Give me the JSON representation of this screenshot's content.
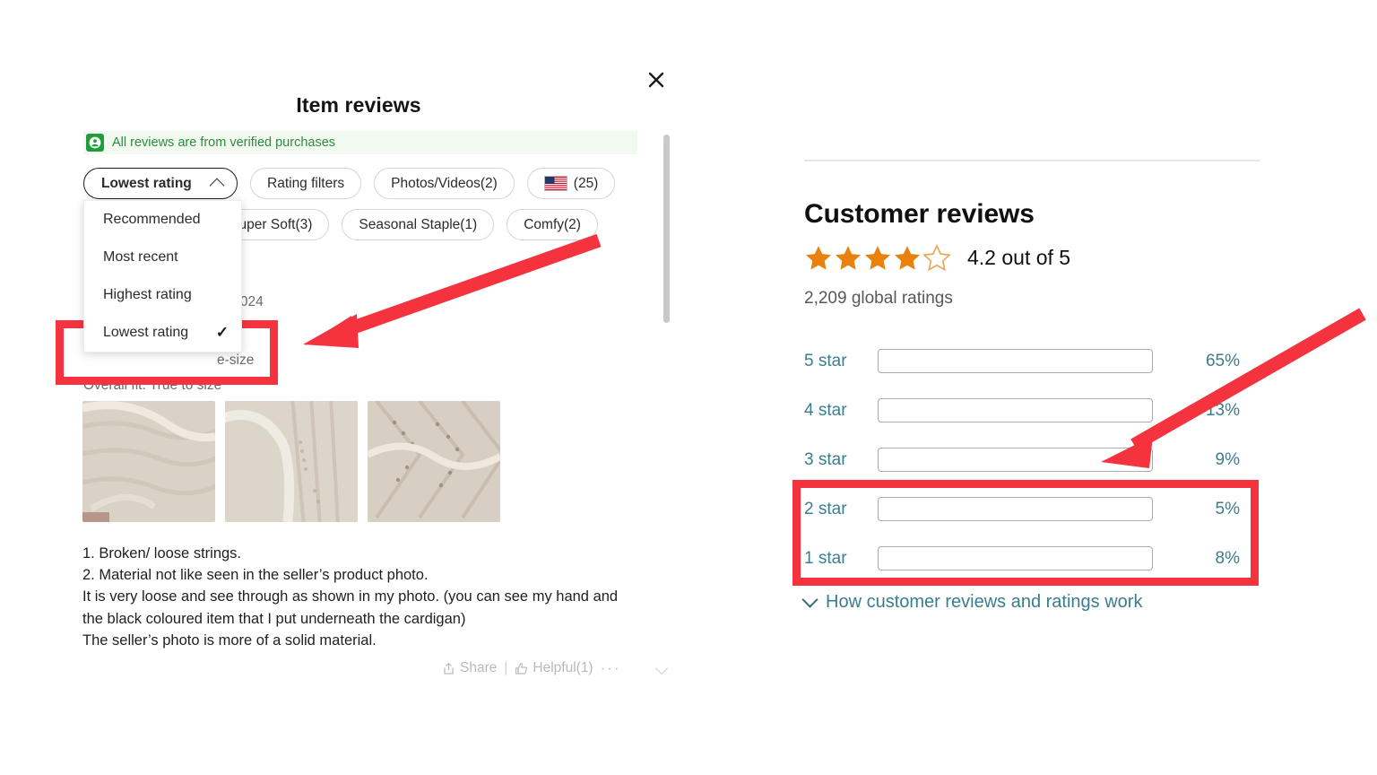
{
  "colors": {
    "annotation_red": "#f5333f",
    "bar_orange": "#e07b16",
    "link_teal": "#3a7d8c",
    "verified_green": "#2e8b3c"
  },
  "left_panel": {
    "title": "Item reviews",
    "close_label": "Close",
    "verified_banner": "All reviews are from verified purchases",
    "chips_row_1": [
      {
        "label": "Lowest rating",
        "type": "sort",
        "expanded": true
      },
      {
        "label": "Rating filters",
        "type": "filter"
      },
      {
        "label": "Photos/Videos(2)",
        "type": "filter"
      },
      {
        "label": "(25)",
        "type": "country",
        "flag": "us-flag-icon"
      }
    ],
    "chips_row_2": [
      {
        "label": "Super Soft(3)",
        "type": "filter"
      },
      {
        "label": "Seasonal Staple(1)",
        "type": "filter"
      },
      {
        "label": "Comfy(2)",
        "type": "filter"
      }
    ],
    "sort_dropdown": {
      "options": [
        {
          "label": "Recommended",
          "selected": false
        },
        {
          "label": "Most recent",
          "selected": false
        },
        {
          "label": "Highest rating",
          "selected": false
        },
        {
          "label": "Lowest rating",
          "selected": true
        }
      ],
      "check_glyph": "✓"
    },
    "review": {
      "date_fragment": "8, 2024",
      "size_fragment": "e-size",
      "overall_fit": "Overall fit: True to size",
      "photo_count": 3,
      "body": "1. Broken/ loose strings.\n2. Material not like seen in the seller’s product photo.\nIt is very loose and see through as shown in my photo. (you can see my hand and the black coloured item that I put underneath the cardigan)\nThe seller’s photo is more of a solid material.",
      "actions": {
        "share": "Share",
        "separator": "|",
        "helpful": "Helpful(1)",
        "more": "···"
      }
    }
  },
  "right_panel": {
    "title": "Customer reviews",
    "stars_filled": 4,
    "stars_total": 5,
    "score_text": "4.2 out of 5",
    "global_ratings": "2,209 global ratings",
    "how_link": "How customer reviews and ratings work"
  },
  "chart_data": {
    "type": "bar",
    "title": "Customer reviews rating distribution",
    "orientation": "horizontal",
    "categories": [
      "5 star",
      "4 star",
      "3 star",
      "2 star",
      "1 star"
    ],
    "values": [
      65,
      13,
      9,
      5,
      8
    ],
    "value_labels": [
      "65%",
      "13%",
      "9%",
      "5%",
      "8%"
    ],
    "xlabel": "",
    "ylabel": "",
    "xlim": [
      0,
      100
    ],
    "grid": false,
    "legend": false,
    "bar_color": "#e07b16",
    "track_color": "#ffffff",
    "label_color": "#3a7d8c",
    "average": 4.2,
    "total_ratings": 2209
  },
  "annotations": [
    {
      "name": "highlight-box-dropdown-lowest-rating",
      "shape": "rectangle",
      "color": "#f5333f"
    },
    {
      "name": "highlight-box-low-star-bars",
      "shape": "rectangle",
      "color": "#f5333f"
    },
    {
      "name": "arrow-to-dropdown",
      "shape": "arrow",
      "color": "#f5333f",
      "direction": "down-left"
    },
    {
      "name": "arrow-to-three-star-bar",
      "shape": "arrow",
      "color": "#f5333f",
      "direction": "down-left"
    }
  ]
}
